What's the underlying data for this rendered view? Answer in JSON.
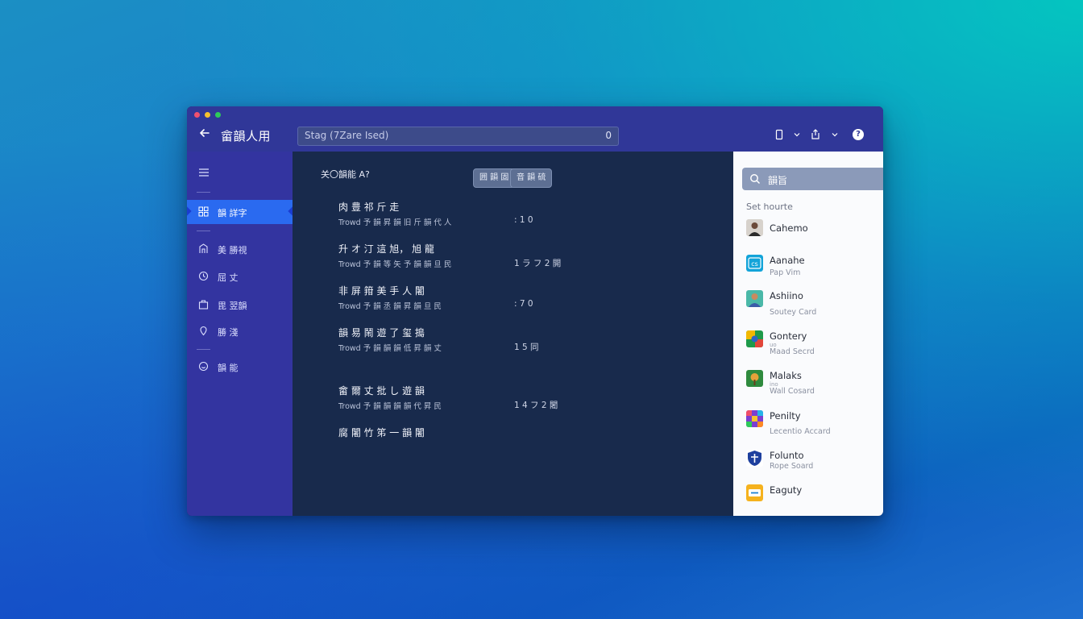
{
  "window": {
    "title": "畲韻人用",
    "traffic_lights": [
      "#f0506e",
      "#f5c12e",
      "#2ec95a"
    ]
  },
  "search": {
    "text": "Stag (7Zare Ised)",
    "count": "0"
  },
  "sidebar": {
    "items": [
      {
        "label": "韻 詳字",
        "icon": "grid-icon",
        "active": true
      },
      {
        "label": "美 勝視",
        "icon": "building-icon",
        "active": false
      },
      {
        "label": "屈 丈",
        "icon": "clock-icon",
        "active": false
      },
      {
        "label": "毘 翌韻",
        "icon": "bag-icon",
        "active": false
      },
      {
        "label": "勝 淺",
        "icon": "pin-icon",
        "active": false
      },
      {
        "label": "韻 能",
        "icon": "smile-icon",
        "active": false
      }
    ]
  },
  "main": {
    "heading": "关〇韻能 A?",
    "pills": [
      "囲 韻 固",
      "音 韻 硫"
    ],
    "rows": [
      {
        "title": "肉 豊 祁  斤 走",
        "sub": "Trowd  予 韻 昇 韻 旧 斤 韻 代 人",
        "value": ": 1 0"
      },
      {
        "title": "升 オ 汀  這 旭， 旭 龍",
        "sub": "Trowd  予 韻 等 矢 予 韻 韻 旦 民",
        "value": "1 ラ フ 2 開"
      },
      {
        "title": "非 屏 箝 美 手 人 闍",
        "sub": "Trowd  予 韻 丞 韻 昇 韻 旦 民",
        "value": ": 7 0"
      },
      {
        "title": "韻 易 鬧 遊 了 玺 搗",
        "sub": "Trowd  予 韻 韻 韻 低 昇 韻 丈",
        "value": "1 5 同"
      },
      {
        "title": "畲 爾 丈 批 し 遊 韻",
        "sub": "Trowd  予 韻 韻 韻 韻 代 昇 民",
        "value": "1 4 フ 2 闍"
      },
      {
        "title": "腐 闍 竹 笫 一 韻 闍",
        "sub": "",
        "value": ""
      }
    ]
  },
  "panel": {
    "search_label": "韻旨",
    "section_title": "Set hourte",
    "items": [
      {
        "name": "Cahemo",
        "sub": "",
        "tiny": "",
        "icon": "person-avatar-icon"
      },
      {
        "name": "Aanahe",
        "sub": "Pap Vim",
        "tiny": "",
        "icon": "cs-app-icon"
      },
      {
        "name": "Ashiino",
        "sub": "Soutey Card",
        "tiny": "",
        "icon": "portrait-avatar-icon"
      },
      {
        "name": "Gontery",
        "sub": "Maad Secrd",
        "tiny": "uo",
        "icon": "color-tile-icon"
      },
      {
        "name": "Malaks",
        "sub": "Wall Cosard",
        "tiny": "ino",
        "icon": "tree-avatar-icon"
      },
      {
        "name": "Penilty",
        "sub": "Lecentio Accard",
        "tiny": "",
        "icon": "mosaic-app-icon"
      },
      {
        "name": "Folunto",
        "sub": "Rope Soard",
        "tiny": "",
        "icon": "shield-app-icon"
      },
      {
        "name": "Eaguty",
        "sub": "",
        "tiny": "",
        "icon": "ticket-app-icon"
      }
    ]
  },
  "colors": {
    "titlebar": "#303798",
    "sidebar": "#3334a0",
    "active": "#2a6af0",
    "main": "#182a4c",
    "panel": "#fafbfd"
  }
}
